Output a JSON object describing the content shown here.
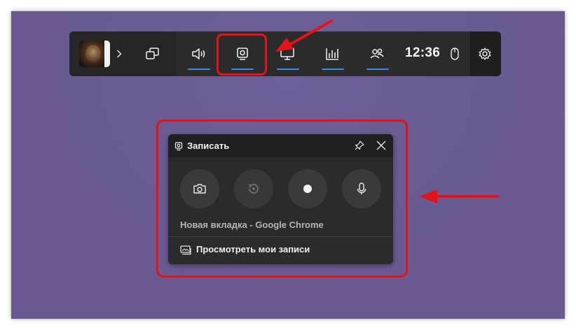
{
  "gamebar": {
    "clock": "12:36",
    "icons": [
      "avatar",
      "chevron-right-icon",
      "widget-menu-icon",
      "audio-icon",
      "capture-icon",
      "performance-icon",
      "resources-icon",
      "social-icon",
      "mouse-icon",
      "gear-icon"
    ],
    "accent_color": "#3a8ee6"
  },
  "capture_panel": {
    "title": "Записать",
    "buttons": [
      "screenshot-button",
      "record-last-button",
      "start-recording-button",
      "microphone-button"
    ],
    "source": "Новая вкладка - Google Chrome",
    "view_recordings": "Просмотреть мои записи"
  },
  "annotation_color": "#e3121b"
}
